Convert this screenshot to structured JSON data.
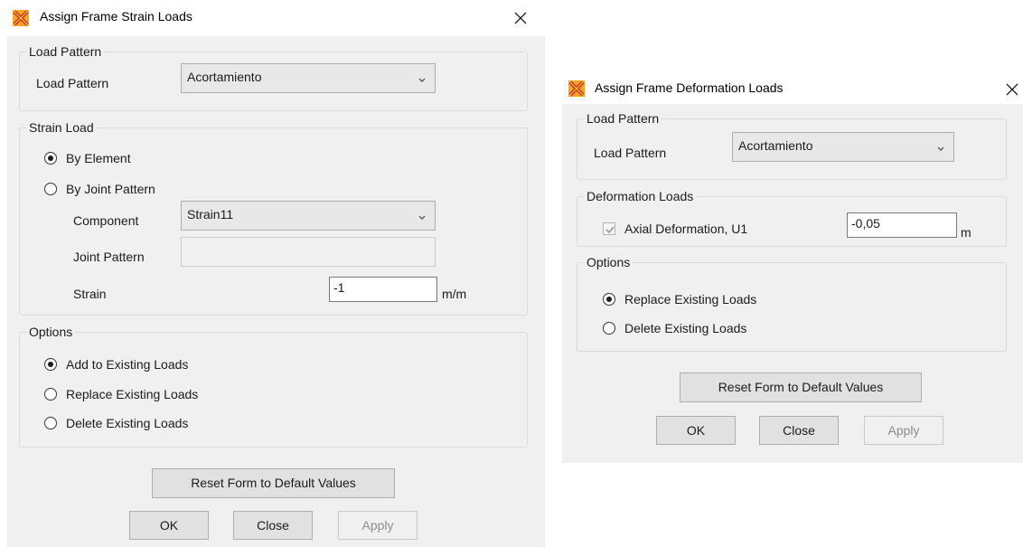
{
  "strain_dialog": {
    "title": "Assign Frame Strain Loads",
    "load_pattern_group": {
      "legend": "Load Pattern",
      "label": "Load Pattern",
      "value": "Acortamiento"
    },
    "strain_load_group": {
      "legend": "Strain Load",
      "by_element": "By Element",
      "by_joint_pattern": "By Joint Pattern",
      "selected": "By Element",
      "component_label": "Component",
      "component_value": "Strain11",
      "joint_pattern_label": "Joint Pattern",
      "joint_pattern_value": "",
      "strain_label": "Strain",
      "strain_value": "-1",
      "strain_unit": "m/m"
    },
    "options_group": {
      "legend": "Options",
      "items": [
        "Add to Existing Loads",
        "Replace Existing Loads",
        "Delete Existing Loads"
      ],
      "selected": "Add to Existing Loads"
    },
    "reset_button": "Reset Form to Default Values",
    "ok_button": "OK",
    "close_button": "Close",
    "apply_button": "Apply"
  },
  "deformation_dialog": {
    "title": "Assign Frame Deformation Loads",
    "load_pattern_group": {
      "legend": "Load Pattern",
      "label": "Load Pattern",
      "value": "Acortamiento"
    },
    "deformation_group": {
      "legend": "Deformation Loads",
      "axial_label": "Axial Deformation, U1",
      "axial_checked": true,
      "axial_value": "-0,05",
      "axial_unit": "m"
    },
    "options_group": {
      "legend": "Options",
      "items": [
        "Replace Existing Loads",
        "Delete Existing Loads"
      ],
      "selected": "Replace Existing Loads"
    },
    "reset_button": "Reset Form to Default Values",
    "ok_button": "OK",
    "close_button": "Close",
    "apply_button": "Apply"
  }
}
